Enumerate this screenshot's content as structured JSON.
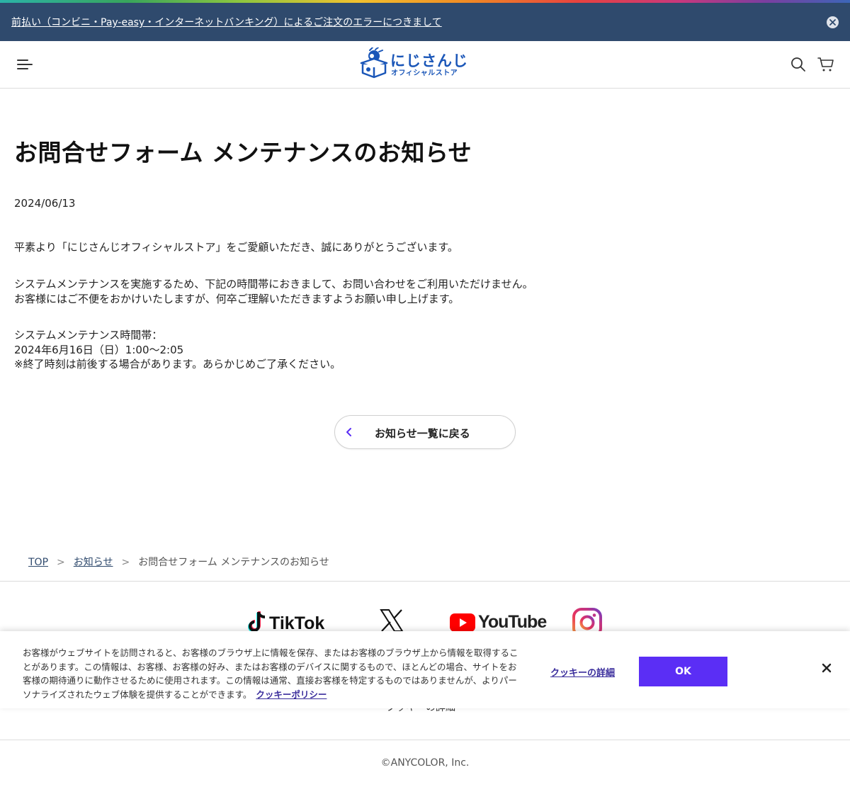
{
  "announcement": {
    "text": "前払い（コンビニ・Pay-easy・インターネットバンキング）によるご注文のエラーにつきまして"
  },
  "header": {
    "logo_main": "にじさんじ",
    "logo_sub": "オフィシャルストア"
  },
  "article": {
    "title": "お問合せフォーム メンテナンスのお知らせ",
    "date": "2024/06/13",
    "paragraphs": [
      [
        "平素より「にじさんじオフィシャルストア」をご愛顧いただき、誠にありがとうございます。"
      ],
      [
        "システムメンテナンスを実施するため、下記の時間帯におきまして、お問い合わせをご利用いただけません。",
        "お客様にはご不便をおかけいたしますが、何卒ご理解いただきますようお願い申し上げます。"
      ],
      [
        "システムメンテナンス時間帯：",
        "2024年6月16日（日）1:00〜2:05",
        "※終了時刻は前後する場合があります。あらかじめご了承ください。"
      ]
    ]
  },
  "back_button": {
    "label": "お知らせ一覧に戻る"
  },
  "breadcrumb": {
    "items": [
      "TOP",
      "お知らせ",
      "お問合せフォーム メンテナンスのお知らせ"
    ],
    "separator": ">"
  },
  "social": {
    "tiktok_label": "TikTok",
    "youtube_label": "YouTube"
  },
  "footer": {
    "cookie_link_behind": "クッキーの詳細",
    "copyright": "©ANYCOLOR, Inc."
  },
  "cookie_banner": {
    "text": "お客様がウェブサイトを訪問されると、お客様のブラウザ上に情報を保存、またはお客様のブラウザ上から情報を取得することがあります。この情報は、お客様、お客様の好み、またはお客様のデバイスに関するもので、ほとんどの場合、サイトをお客様の期待通りに動作させるために使用されます。この情報は通常、直接お客様を特定するものではありませんが、よりパーソナライズされたウェブ体験を提供することができます。",
    "policy_link": "クッキーポリシー",
    "details_link": "クッキーの詳細",
    "ok_label": "OK"
  },
  "colors": {
    "announcement_bg": "#2f4a6d",
    "brand_blue": "#1a56b8",
    "ok_button": "#5b2ef5",
    "link_purple": "#3a2d9c"
  }
}
